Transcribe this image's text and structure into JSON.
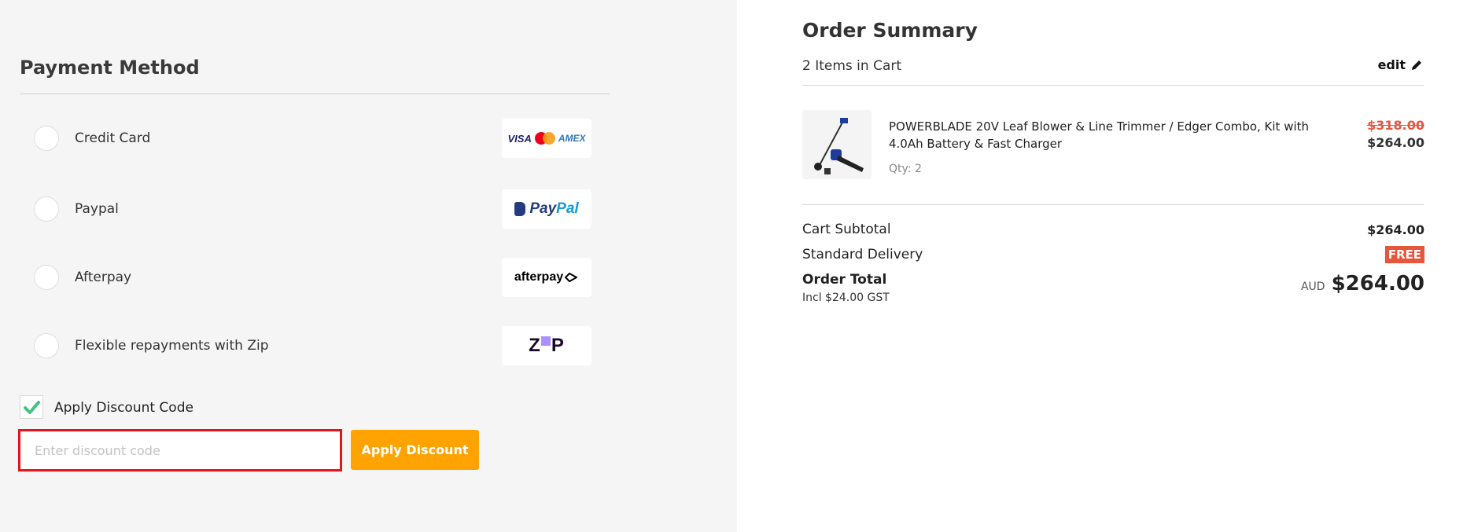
{
  "payment": {
    "title": "Payment Method",
    "methods": [
      {
        "label": "Credit Card",
        "logo": "card-logos",
        "logo_text": [
          "VISA",
          "AMEX"
        ]
      },
      {
        "label": "Paypal",
        "logo": "paypal-logo",
        "logo_text": [
          "Pay",
          "Pal"
        ]
      },
      {
        "label": "Afterpay",
        "logo": "afterpay-logo",
        "logo_text": [
          "afterpay"
        ]
      },
      {
        "label": "Flexible repayments with Zip",
        "logo": "zip-logo",
        "logo_text": [
          "Z",
          "P"
        ]
      }
    ],
    "discount_checkbox_label": "Apply Discount Code",
    "discount_checked": true,
    "discount_placeholder": "Enter discount code",
    "discount_value": "",
    "apply_button": "Apply Discount"
  },
  "summary": {
    "title": "Order Summary",
    "item_count": "2 Items in Cart",
    "edit_label": "edit",
    "items": [
      {
        "name": "POWERBLADE 20V Leaf Blower & Line Trimmer / Edger Combo, Kit with 4.0Ah Battery & Fast Charger",
        "qty": "Qty: 2",
        "original_price": "$318.00",
        "price": "$264.00"
      }
    ],
    "subtotal_label": "Cart Subtotal",
    "subtotal_value": "$264.00",
    "delivery_label": "Standard Delivery",
    "delivery_value": "FREE",
    "total_label": "Order Total",
    "gst_note": "Incl $24.00 GST",
    "currency": "AUD",
    "total_value": "$264.00"
  },
  "colors": {
    "accent": "#ffa303",
    "sale_red": "#e8553d",
    "highlight_border": "#e8141b",
    "check_green": "#3fc47d"
  }
}
